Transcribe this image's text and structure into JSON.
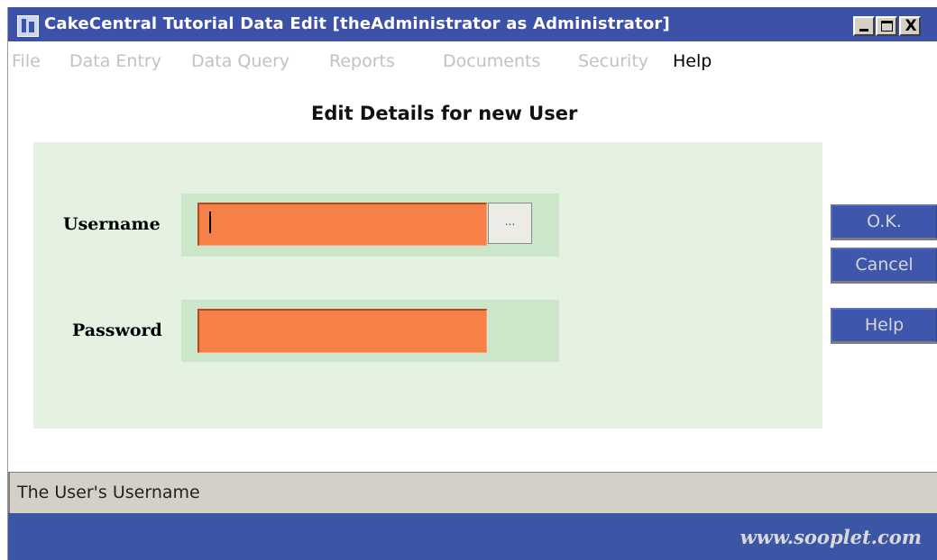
{
  "window": {
    "title": "CakeCentral Tutorial Data Edit [theAdministrator as Administrator]",
    "controls": {
      "minimize": "_",
      "maximize": "□",
      "close": "X"
    }
  },
  "menu": {
    "items": [
      {
        "label": "File",
        "enabled": false
      },
      {
        "label": "Data Entry",
        "enabled": false
      },
      {
        "label": "Data Query",
        "enabled": false
      },
      {
        "label": "Reports",
        "enabled": false
      },
      {
        "label": "Documents",
        "enabled": false
      },
      {
        "label": "Security",
        "enabled": false
      },
      {
        "label": "Help",
        "enabled": true
      }
    ]
  },
  "form": {
    "heading": "Edit Details for new User",
    "username": {
      "label": "Username",
      "value": "",
      "lookup_label": "..."
    },
    "password": {
      "label": "Password",
      "value": ""
    }
  },
  "buttons": {
    "ok": "O.K.",
    "cancel": "Cancel",
    "help": "Help"
  },
  "status": {
    "text": "The User's Username"
  },
  "footer": {
    "text": "www.sooplet.com"
  },
  "colors": {
    "titlebar": "#3c51a8",
    "input_bg": "#f68047",
    "panel_bg": "#e5f2e2",
    "field_bg": "#cbe6c9",
    "button_bg": "#3f56ad",
    "footer_bg": "#3c56a6"
  }
}
